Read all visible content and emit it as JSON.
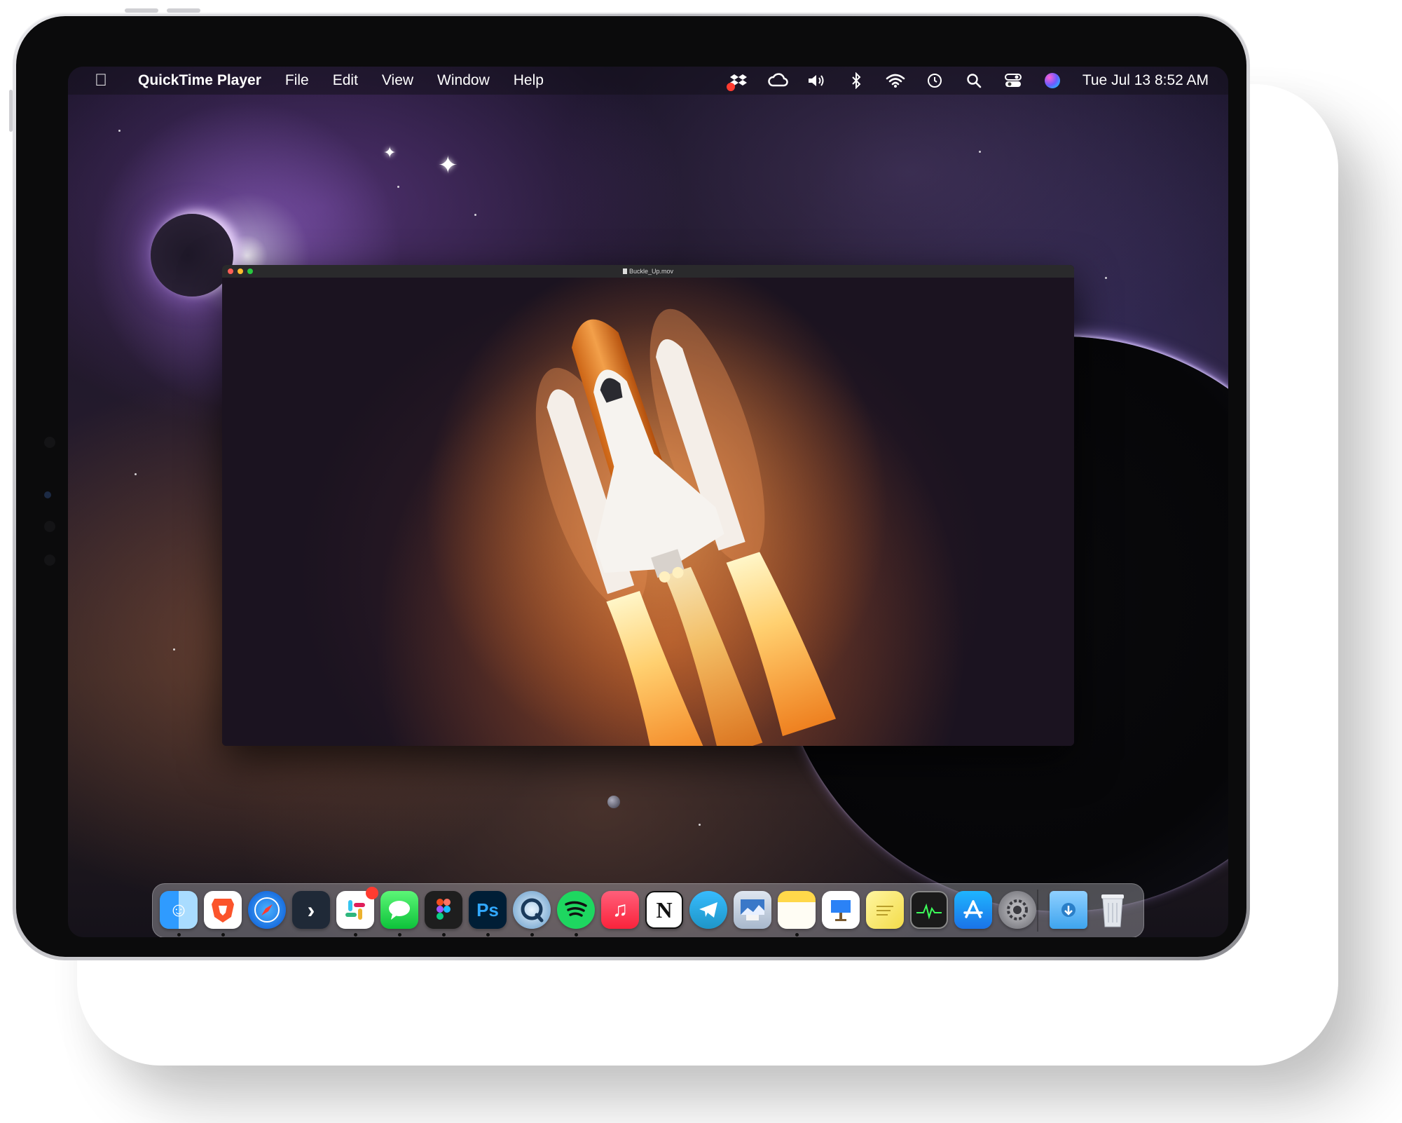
{
  "menubar": {
    "app_name": "QuickTime Player",
    "menus": [
      "File",
      "Edit",
      "View",
      "Window",
      "Help"
    ],
    "status_icons": [
      "dropbox-icon",
      "creative-cloud-icon",
      "volume-icon",
      "bluetooth-icon",
      "wifi-icon",
      "time-machine-icon",
      "spotlight-search-icon",
      "control-center-icon",
      "siri-icon"
    ],
    "clock": "Tue Jul 13  8:52 AM"
  },
  "window": {
    "title": "Buckle_Up.mov"
  },
  "dock": {
    "apps": [
      {
        "name": "finder-icon",
        "running": true
      },
      {
        "name": "brave-browser-icon",
        "running": true
      },
      {
        "name": "safari-icon",
        "running": false
      },
      {
        "name": "prompt-icon",
        "running": false
      },
      {
        "name": "slack-icon",
        "running": true,
        "badge": true
      },
      {
        "name": "messages-icon",
        "running": true
      },
      {
        "name": "figma-icon",
        "running": true
      },
      {
        "name": "photoshop-icon",
        "running": true
      },
      {
        "name": "quicktime-icon",
        "running": true
      },
      {
        "name": "spotify-icon",
        "running": true
      },
      {
        "name": "music-icon",
        "running": false
      },
      {
        "name": "notion-icon",
        "running": false
      },
      {
        "name": "telegram-icon",
        "running": false
      },
      {
        "name": "preview-icon",
        "running": false
      },
      {
        "name": "notes-icon",
        "running": true
      },
      {
        "name": "keynote-icon",
        "running": false
      },
      {
        "name": "stickies-icon",
        "running": false
      },
      {
        "name": "activity-monitor-icon",
        "running": false
      },
      {
        "name": "app-store-icon",
        "running": false
      },
      {
        "name": "system-preferences-icon",
        "running": false
      },
      {
        "name": "downloads-folder-icon",
        "running": false
      },
      {
        "name": "trash-icon",
        "running": false
      }
    ],
    "labels": {
      "photoshop": "Ps",
      "notion": "N"
    }
  },
  "colors": {
    "menubar": "#14101c",
    "traffic_close": "#ff5f57",
    "traffic_minimize": "#febc2e",
    "traffic_zoom": "#28c840",
    "badge": "#ff3b30"
  }
}
